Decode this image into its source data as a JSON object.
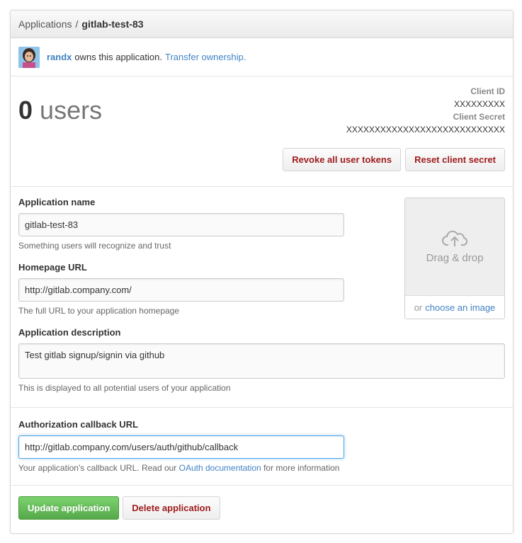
{
  "breadcrumb": {
    "parent": "Applications",
    "separator": "/",
    "current": "gitlab-test-83"
  },
  "owner": {
    "username": "randx",
    "text": "owns this application.",
    "transfer_link": "Transfer ownership."
  },
  "stats": {
    "user_count": "0",
    "user_label": "users",
    "client_id_label": "Client ID",
    "client_id_value": "XXXXXXXXX",
    "client_secret_label": "Client Secret",
    "client_secret_value": "XXXXXXXXXXXXXXXXXXXXXXXXXXXX",
    "revoke_button": "Revoke all user tokens",
    "reset_button": "Reset client secret"
  },
  "form": {
    "app_name": {
      "label": "Application name",
      "value": "gitlab-test-83",
      "hint": "Something users will recognize and trust"
    },
    "homepage": {
      "label": "Homepage URL",
      "value": "http://gitlab.company.com/",
      "hint": "The full URL to your application homepage"
    },
    "description": {
      "label": "Application description",
      "value": "Test gitlab signup/signin via github",
      "hint": "This is displayed to all potential users of your application"
    },
    "callback": {
      "label": "Authorization callback URL",
      "value": "http://gitlab.company.com/users/auth/github/callback",
      "hint_prefix": "Your application's callback URL. Read our",
      "hint_link": "OAuth documentation",
      "hint_suffix": "for more information"
    }
  },
  "logo_upload": {
    "drag_text": "Drag & drop",
    "or_text": "or",
    "choose_link": "choose an image",
    "icon": "cloud-upload-icon"
  },
  "actions": {
    "update_button": "Update application",
    "delete_button": "Delete application"
  },
  "colors": {
    "link": "#4183c4",
    "danger": "#9e1b1b",
    "primary": "#55a84a",
    "focus": "#51a7e8"
  }
}
